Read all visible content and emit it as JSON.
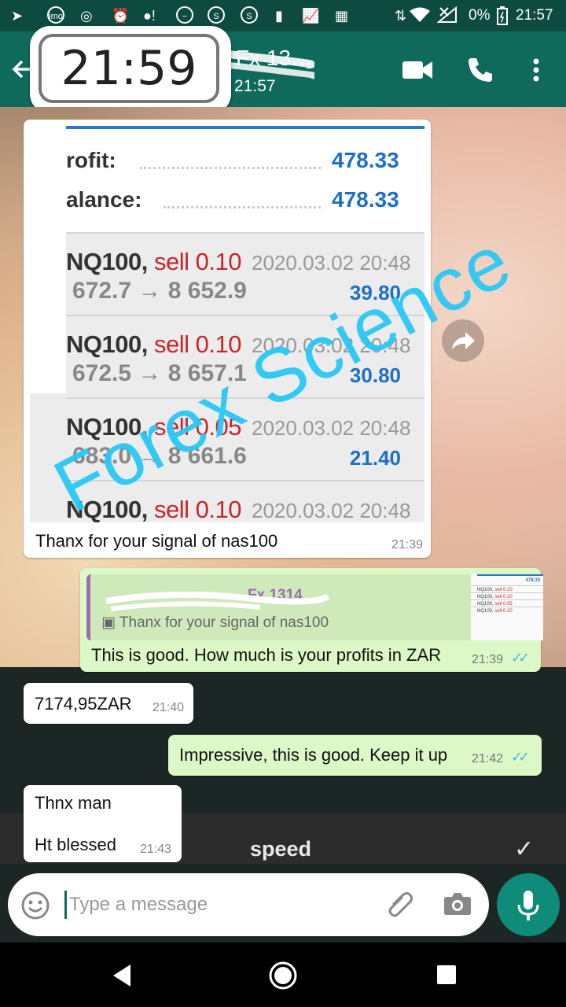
{
  "status_bar": {
    "battery": "0%",
    "time": "21:57"
  },
  "header": {
    "contact_name": "Fx 13…",
    "last_seen": "21:57"
  },
  "clock_overlay": "21:59",
  "messages": {
    "image_message": {
      "caption": "Thanx for your signal of nas100",
      "time": "21:39",
      "screenshot": {
        "profit_label": "rofit:",
        "profit_value": "478.33",
        "balance_label": "alance:",
        "balance_value": "478.33",
        "trades": [
          {
            "symbol": "NQ100,",
            "side": "sell 0.10",
            "date": "2020.03.02 20:48",
            "prices": "672.7 → 8 652.9",
            "profit": "39.80"
          },
          {
            "symbol": "NQ100,",
            "side": "sell 0.10",
            "date": "2020.03.02 20:48",
            "prices": "672.5 → 8 657.1",
            "profit": "30.80"
          },
          {
            "symbol": "NQ100,",
            "side": "sell 0.05",
            "date": "2020.03.02 20:48",
            "prices": "683.0 → 8 661.6",
            "profit": "21.40"
          },
          {
            "symbol": "NQ100,",
            "side": "sell 0.10",
            "date": "2020.03.02 20:48",
            "prices": "",
            "profit": ""
          }
        ]
      }
    },
    "reply_message": {
      "quoted_author": "Fx 1314",
      "quoted_text": "Thanx for your signal of nas100",
      "text": "This is good. How much is your profits in ZAR",
      "time": "21:39"
    },
    "incoming_2": {
      "text": "7174,95ZAR",
      "time": "21:40"
    },
    "outgoing_2": {
      "text": "Impressive, this is good. Keep it up",
      "time": "21:42"
    },
    "incoming_3": {
      "line1": "Thnx man",
      "line2": "Ht blessed",
      "time": "21:43"
    }
  },
  "keyboard": {
    "suggestion": "speed"
  },
  "composer": {
    "placeholder": "Type a message",
    "value": ""
  },
  "watermark": "Forex Science",
  "colors": {
    "header": "#0f6a5c",
    "status_bar": "#0d4b41",
    "outgoing_bubble": "#dcf8c6",
    "read_ticks": "#4fb6ec",
    "watermark": "#28c8f5",
    "profit_blue": "#1e6fc8",
    "sell_red": "#c8262b"
  }
}
